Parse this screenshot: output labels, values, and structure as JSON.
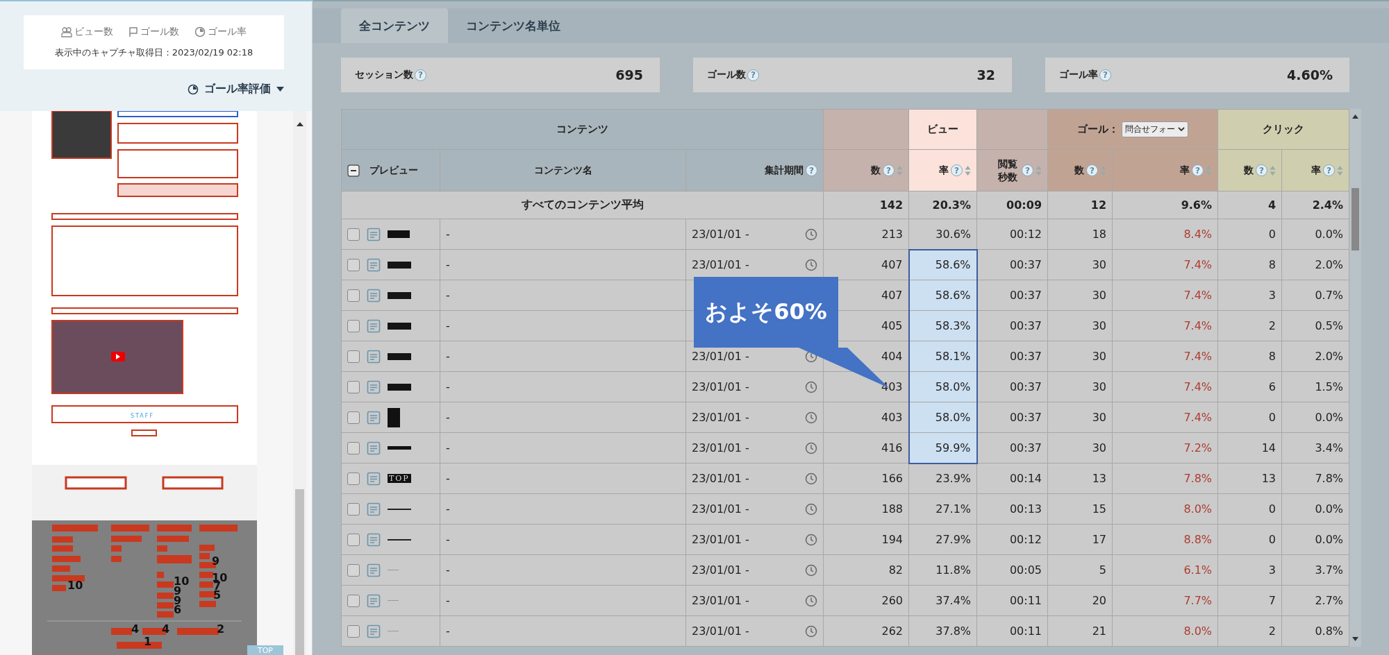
{
  "left_panel": {
    "legend": [
      {
        "kind": "views",
        "label": "ビュー数"
      },
      {
        "kind": "goals",
        "label": "ゴール数"
      },
      {
        "kind": "rate",
        "label": "ゴール率"
      }
    ],
    "capture_date": "表示中のキャプチャ取得日：2023/02/19 02:18",
    "mode_menu": "ゴール率評価",
    "preview": {
      "staff_label": "STAFF",
      "top_button": "TOP",
      "counts": [
        "9",
        "10",
        "10",
        "10",
        "7",
        "9",
        "5",
        "9",
        "6",
        "4",
        "4",
        "2",
        "1"
      ]
    }
  },
  "tabs": [
    {
      "label": "全コンテンツ",
      "selected": true
    },
    {
      "label": "コンテンツ名単位",
      "selected": false
    }
  ],
  "stats": [
    {
      "label": "セッション数",
      "help": "?",
      "value": "695"
    },
    {
      "label": "ゴール数",
      "help": "?",
      "value": "32"
    },
    {
      "label": "ゴール率",
      "help": "?",
      "value": "4.60%"
    }
  ],
  "table": {
    "groups": [
      {
        "kind": "content",
        "label": "コンテンツ"
      },
      {
        "kind": "view",
        "label": "ビュー"
      },
      {
        "kind": "goal",
        "label": "ゴール：",
        "select": "問合せフォー"
      },
      {
        "kind": "click",
        "label": "クリック"
      }
    ],
    "columns": [
      {
        "kind": "preview",
        "label": "プレビュー"
      },
      {
        "kind": "name",
        "label": "コンテンツ名"
      },
      {
        "kind": "period",
        "label": "集計期間",
        "help": "?"
      },
      {
        "kind": "view",
        "label": "数",
        "help": "?",
        "highlighted": false
      },
      {
        "kind": "view",
        "label": "率",
        "help": "?",
        "highlighted": true
      },
      {
        "kind": "view",
        "label": "閲覧秒数",
        "help": "?",
        "highlighted": false
      },
      {
        "kind": "goal",
        "label": "数",
        "help": "?",
        "highlighted": false
      },
      {
        "kind": "goal",
        "label": "率",
        "help": "?",
        "highlighted": false
      },
      {
        "kind": "click",
        "label": "数",
        "help": "?",
        "highlighted": false
      },
      {
        "kind": "click",
        "label": "率",
        "help": "?",
        "highlighted": false
      }
    ],
    "average": {
      "label": "すべてのコンテンツ平均",
      "values": [
        "142",
        "20.3%",
        "00:09",
        "12",
        "9.6%",
        "4",
        "2.4%"
      ]
    },
    "rows": [
      {
        "checked": false,
        "thumbnail": {
          "kind": "block"
        },
        "name": "-",
        "period": "23/01/01 -",
        "values": [
          "213",
          "30.6%",
          "00:12",
          "18",
          "8.4%",
          "0",
          "0.0%"
        ],
        "highlighted": false
      },
      {
        "checked": false,
        "thumbnail": {
          "kind": "label"
        },
        "name": "-",
        "period": "23/01/01 -",
        "values": [
          "407",
          "58.6%",
          "00:37",
          "30",
          "7.4%",
          "8",
          "2.0%"
        ],
        "highlighted": true
      },
      {
        "checked": false,
        "thumbnail": {
          "kind": "label"
        },
        "name": "-",
        "values": [
          "407",
          "58.6%",
          "00:37",
          "30",
          "7.4%",
          "3",
          "0.7%"
        ],
        "highlighted": true
      },
      {
        "checked": false,
        "thumbnail": {
          "kind": "label"
        },
        "name": "-",
        "values": [
          "405",
          "58.3%",
          "00:37",
          "30",
          "7.4%",
          "2",
          "0.5%"
        ],
        "highlighted": true
      },
      {
        "checked": false,
        "thumbnail": {
          "kind": "label"
        },
        "name": "-",
        "period": "23/01/01 -",
        "values": [
          "404",
          "58.1%",
          "00:37",
          "30",
          "7.4%",
          "8",
          "2.0%"
        ],
        "highlighted": true
      },
      {
        "checked": false,
        "thumbnail": {
          "kind": "label"
        },
        "name": "-",
        "period": "23/01/01 -",
        "values": [
          "403",
          "58.0%",
          "00:37",
          "30",
          "7.4%",
          "6",
          "1.5%"
        ],
        "highlighted": true
      },
      {
        "checked": false,
        "thumbnail": {
          "kind": "tall"
        },
        "name": "-",
        "period": "23/01/01 -",
        "values": [
          "403",
          "58.0%",
          "00:37",
          "30",
          "7.4%",
          "0",
          "0.0%"
        ],
        "highlighted": true
      },
      {
        "checked": false,
        "thumbnail": {
          "kind": "bar"
        },
        "name": "-",
        "period": "23/01/01 -",
        "values": [
          "416",
          "59.9%",
          "00:37",
          "30",
          "7.2%",
          "14",
          "3.4%"
        ],
        "highlighted": true
      },
      {
        "checked": false,
        "thumbnail": {
          "kind": "text",
          "text": "TOP"
        },
        "name": "-",
        "period": "23/01/01 -",
        "values": [
          "166",
          "23.9%",
          "00:14",
          "13",
          "7.8%",
          "13",
          "7.8%"
        ],
        "highlighted": false
      },
      {
        "checked": false,
        "thumbnail": {
          "kind": "line"
        },
        "name": "-",
        "period": "23/01/01 -",
        "values": [
          "188",
          "27.1%",
          "00:13",
          "15",
          "8.0%",
          "0",
          "0.0%"
        ],
        "highlighted": false
      },
      {
        "checked": false,
        "thumbnail": {
          "kind": "line"
        },
        "name": "-",
        "period": "23/01/01 -",
        "values": [
          "194",
          "27.9%",
          "00:12",
          "17",
          "8.8%",
          "0",
          "0.0%"
        ],
        "highlighted": false
      },
      {
        "checked": false,
        "thumbnail": {
          "kind": "faint"
        },
        "name": "-",
        "period": "23/01/01 -",
        "values": [
          "82",
          "11.8%",
          "00:05",
          "5",
          "6.1%",
          "3",
          "3.7%"
        ],
        "highlighted": false
      },
      {
        "checked": false,
        "thumbnail": {
          "kind": "faint"
        },
        "name": "-",
        "period": "23/01/01 -",
        "values": [
          "260",
          "37.4%",
          "00:11",
          "20",
          "7.7%",
          "7",
          "2.7%"
        ],
        "highlighted": false
      },
      {
        "checked": false,
        "thumbnail": {
          "kind": "faint"
        },
        "name": "-",
        "period": "23/01/01 -",
        "values": [
          "262",
          "37.8%",
          "00:11",
          "21",
          "8.0%",
          "2",
          "0.8%"
        ],
        "highlighted": false
      }
    ]
  },
  "callout": {
    "text": "およそ60%"
  }
}
